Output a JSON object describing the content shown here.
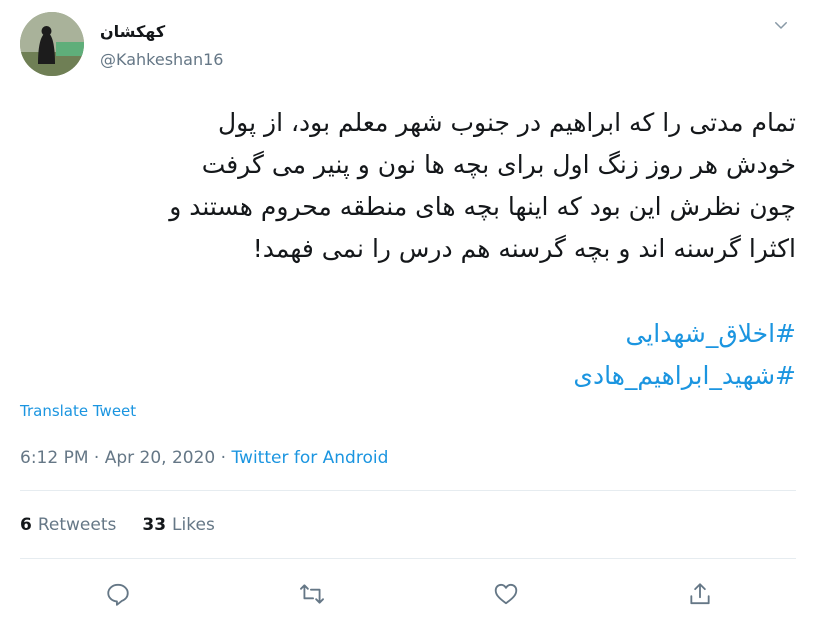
{
  "author": {
    "display_name": "کهکشان",
    "handle": "@Kahkeshan16"
  },
  "tweet": {
    "text": "تمام مدتی را که ابراهیم در جنوب شهر معلم بود، از پول\nخودش هر روز زنگ اول برای بچه ها نون و پنیر می گرفت\nچون نظرش این بود که اینها بچه های منطقه محروم هستند و\nاکثرا گرسنه اند و بچه گرسنه هم درس را نمی فهمد!",
    "hashtags": [
      "#اخلاق_شهدایی",
      "#شهید_ابراهیم_هادی"
    ],
    "translate_label": "Translate Tweet",
    "time": "6:12 PM",
    "separator": "·",
    "date": "Apr 20, 2020",
    "source": "Twitter for Android"
  },
  "stats": {
    "retweets_count": "6",
    "retweets_label": "Retweets",
    "likes_count": "33",
    "likes_label": "Likes"
  },
  "icons": {
    "caret": "chevron-down-icon",
    "reply": "reply-icon",
    "retweet": "retweet-icon",
    "like": "heart-icon",
    "share": "share-icon"
  },
  "colors": {
    "accent": "#1b95e0",
    "secondary_text": "#657786",
    "icon": "#657786"
  }
}
